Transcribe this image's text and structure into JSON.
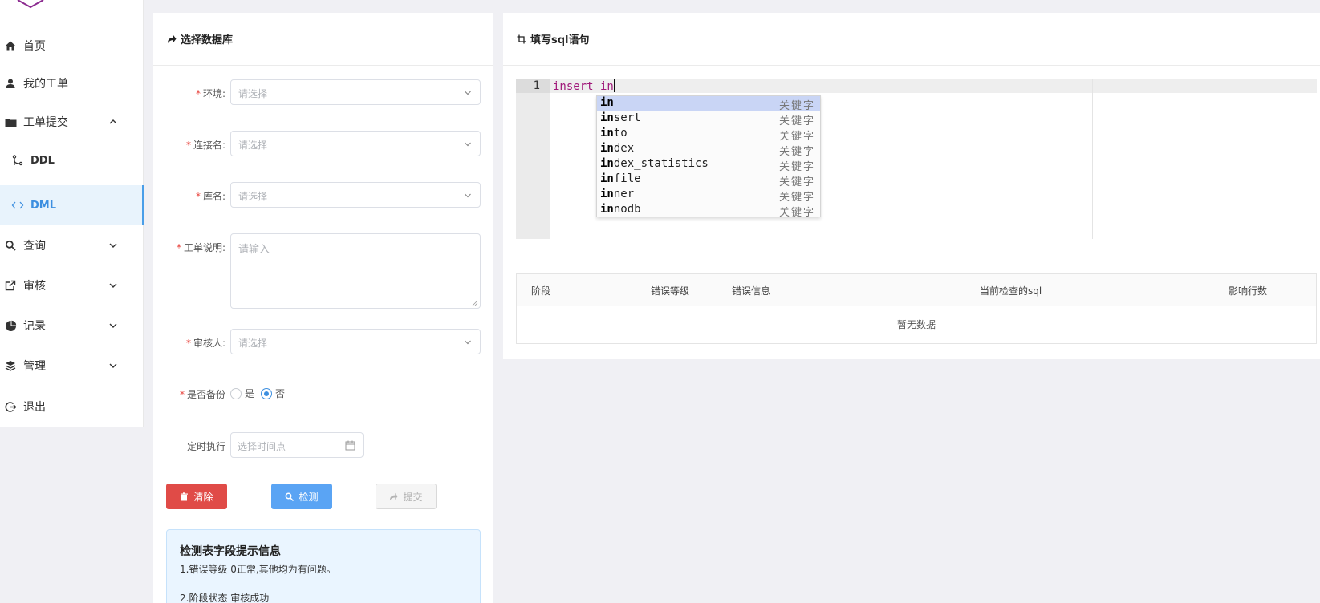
{
  "sidebar": {
    "items": [
      {
        "label": "首页",
        "icon": "home-icon"
      },
      {
        "label": "我的工单",
        "icon": "user-icon"
      },
      {
        "label": "工单提交",
        "icon": "folder-icon",
        "expanded": true
      },
      {
        "label": "DDL",
        "icon": "branch-icon"
      },
      {
        "label": "DML",
        "icon": "code-icon",
        "active": true
      },
      {
        "label": "查询",
        "icon": "search-icon"
      },
      {
        "label": "审核",
        "icon": "external-link-icon"
      },
      {
        "label": "记录",
        "icon": "pie-chart-icon"
      },
      {
        "label": "管理",
        "icon": "layers-icon"
      },
      {
        "label": "退出",
        "icon": "logout-icon"
      }
    ]
  },
  "left_panel": {
    "title": "选择数据库",
    "fields": {
      "env": {
        "label": "环境:",
        "placeholder": "请选择",
        "required": true
      },
      "connection": {
        "label": "连接名:",
        "placeholder": "请选择",
        "required": true
      },
      "database": {
        "label": "库名:",
        "placeholder": "请选择",
        "required": true
      },
      "description": {
        "label": "工单说明:",
        "placeholder": "请输入",
        "required": true
      },
      "reviewer": {
        "label": "审核人:",
        "placeholder": "请选择",
        "required": true
      },
      "backup": {
        "label": "是否备份",
        "required": true,
        "options": [
          "是",
          "否"
        ],
        "selected": "否"
      },
      "schedule": {
        "label": "定时执行",
        "placeholder": "选择时间点"
      }
    },
    "buttons": {
      "clear": "清除",
      "check": "检测",
      "submit": "提交"
    },
    "info": {
      "title": "检测表字段提示信息",
      "line1": "1.错误等级 0正常,其他均为有问题。",
      "line2": "2.阶段状态 审核成功"
    }
  },
  "right_panel": {
    "title": "填写sql语句",
    "editor": {
      "line_number": "1",
      "code": "insert in"
    },
    "autocomplete": {
      "prefix": "in",
      "items": [
        {
          "word": "in",
          "meta": "关键字"
        },
        {
          "word": "insert",
          "meta": "关键字"
        },
        {
          "word": "into",
          "meta": "关键字"
        },
        {
          "word": "index",
          "meta": "关键字"
        },
        {
          "word": "index_statistics",
          "meta": "关键字"
        },
        {
          "word": "infile",
          "meta": "关键字"
        },
        {
          "word": "inner",
          "meta": "关键字"
        },
        {
          "word": "innodb",
          "meta": "关键字"
        }
      ]
    },
    "table": {
      "columns": [
        "阶段",
        "错误等级",
        "错误信息",
        "当前检查的sql",
        "影响行数"
      ],
      "empty_text": "暂无数据"
    }
  },
  "colors": {
    "accent": "#3d8fe0",
    "danger": "#e04b47",
    "required": "#e8403a",
    "keyword": "#a0197a"
  }
}
